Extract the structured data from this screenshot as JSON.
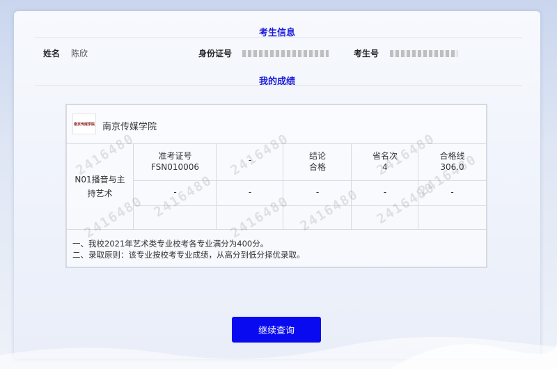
{
  "candidate_section": {
    "title": "考生信息",
    "name_label": "姓名",
    "name_value": "陈欣",
    "id_label": "身份证号",
    "id_value": "",
    "exam_no_label": "考生号",
    "exam_no_value": ""
  },
  "score_section": {
    "title": "我的成绩",
    "school": {
      "logo_text": "南京传媒学院",
      "name": "南京传媒学院"
    },
    "major": "N01播音与主持艺术",
    "columns": [
      {
        "header": "准考证号",
        "value": "FSN010006",
        "row2": "-"
      },
      {
        "header": "",
        "value": "-",
        "row2": "-"
      },
      {
        "header": "结论",
        "value": "合格",
        "row2": "-"
      },
      {
        "header": "省名次",
        "value": "4",
        "row2": "-"
      },
      {
        "header": "合格线",
        "value": "306.0",
        "row2": "-"
      }
    ],
    "notes": [
      "一、我校2021年艺术类专业校考各专业满分为400分。",
      "二、录取原则：该专业按校考专业成绩，从高分到低分择优录取。"
    ],
    "watermark": "2416480"
  },
  "actions": {
    "continue_label": "继续查询"
  },
  "colors": {
    "accent": "#1a1adc",
    "button": "#0a0af0"
  }
}
